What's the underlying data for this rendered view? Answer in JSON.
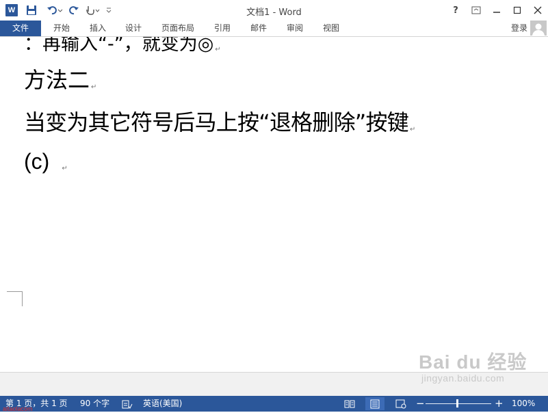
{
  "window": {
    "title": "文档1 - Word",
    "help_label": "?"
  },
  "ribbon": {
    "tabs": [
      {
        "label": "文件"
      },
      {
        "label": "开始"
      },
      {
        "label": "插入"
      },
      {
        "label": "设计"
      },
      {
        "label": "页面布局"
      },
      {
        "label": "引用"
      },
      {
        "label": "邮件"
      },
      {
        "label": "审阅"
      },
      {
        "label": "视图"
      }
    ],
    "login_label": "登录"
  },
  "document": {
    "partial_line": "：再输入“-”，就变为◎",
    "line1": "方法二",
    "line2": "当变为其它符号后马上按“退格删除”按键",
    "line3": "(c)",
    "paragraph_mark": "↵"
  },
  "status_bar": {
    "page_info": "第 1 页，共 1 页",
    "word_count": "90 个字",
    "language": "英语(美国)",
    "zoom_minus": "−",
    "zoom_plus": "+",
    "zoom_level": "100%",
    "zoom_fraction": 0.48
  },
  "watermark": {
    "logo": "Bai du 经验",
    "url": "jingyan.baidu.com"
  },
  "overlay_text": "aitaolacom",
  "colors": {
    "accent": "#2b579a",
    "status_active": "#3c6bb6"
  }
}
